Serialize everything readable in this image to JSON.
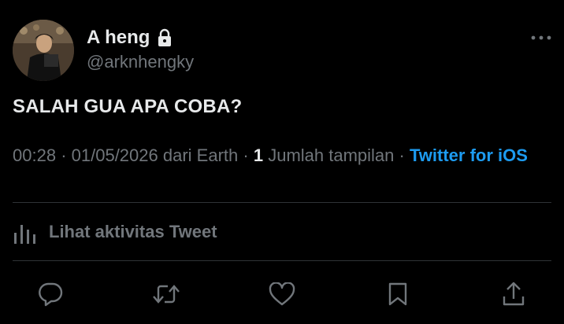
{
  "user": {
    "display_name": "A heng",
    "handle": "@arknhengky"
  },
  "tweet": {
    "text": "SALAH GUA APA COBA?"
  },
  "meta": {
    "time": "00:28",
    "date": "01/05/2026",
    "location": "dari Earth",
    "views_count": "1",
    "views_label": "Jumlah tampilan",
    "source": "Twitter for iOS",
    "separator": "·"
  },
  "activity": {
    "label": "Lihat aktivitas Tweet"
  },
  "colors": {
    "background": "#000000",
    "primary_text": "#e7e9ea",
    "secondary_text": "#71767b",
    "accent": "#1d9bf0",
    "divider": "#2f3336"
  },
  "icons": {
    "lock": "lock-icon",
    "more": "more-icon",
    "activity": "bar-chart-icon",
    "actions": [
      "reply-icon",
      "retweet-icon",
      "like-icon",
      "bookmark-icon",
      "share-icon"
    ]
  }
}
